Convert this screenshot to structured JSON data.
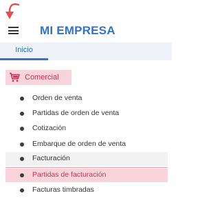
{
  "header": {
    "brand": "MI EMPRESA",
    "menu_icon": "hamburger-menu-icon",
    "pointer_icon": "red-arrow-pointer-icon",
    "brand_color": "#2f74c5"
  },
  "tabs": [
    {
      "label": "Inicio",
      "active": true
    }
  ],
  "sidebar": {
    "section": {
      "label": "Comercial",
      "icon": "cart-icon",
      "color": "#cc2f5a",
      "bg": "#f9d4db"
    },
    "items": [
      {
        "label": "Orden de venta"
      },
      {
        "label": "Partidas de orden de venta"
      },
      {
        "label": "Cotización"
      },
      {
        "label": "Embarque de orden de venta"
      },
      {
        "label": "Facturación",
        "state": "hover"
      },
      {
        "label": "Partidas de facturación",
        "state": "active"
      },
      {
        "label": "Facturas timbradas"
      }
    ]
  }
}
